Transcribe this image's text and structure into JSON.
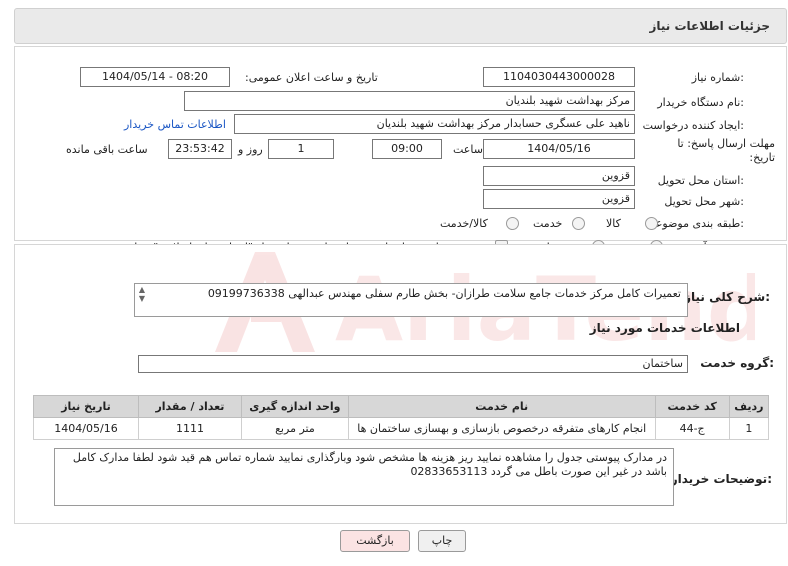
{
  "header": {
    "title": "جزئیات اطلاعات نیاز"
  },
  "need_number": {
    "label": "شماره نیاز:",
    "value": "1104030443000028"
  },
  "announce_datetime": {
    "label": "تاریخ و ساعت اعلان عمومی:",
    "value": "1404/05/14 - 08:20"
  },
  "buyer_org": {
    "label": "نام دستگاه خریدار:",
    "value": "مرکز بهداشت شهید بلندیان"
  },
  "requester": {
    "label": "ایجاد کننده درخواست:",
    "value": "ناهید علی عسگری حسابدار مرکز بهداشت شهید بلندیان",
    "contact_link": "اطلاعات تماس خریدار"
  },
  "deadline": {
    "label": "مهلت ارسال پاسخ: تا تاریخ:",
    "date": "1404/05/16",
    "time_label": "ساعت",
    "time": "09:00",
    "days": "1",
    "days_label": "روز و",
    "remaining": "23:53:42",
    "remaining_label": "ساعت باقی مانده"
  },
  "province": {
    "label": "استان محل تحویل:",
    "value": "قزوین"
  },
  "city": {
    "label": "شهر محل تحویل:",
    "value": "قزوین"
  },
  "category": {
    "label": "طبقه بندی موضوعی:",
    "options": [
      {
        "label": "کالا",
        "selected": false
      },
      {
        "label": "خدمت",
        "selected": false
      },
      {
        "label": "کالا/خدمت",
        "selected": false
      }
    ]
  },
  "purchase_type": {
    "label": "نوع فرآیند خرید :",
    "options": [
      {
        "label": "جزیی",
        "selected": false
      },
      {
        "label": "متوسط",
        "selected": false
      }
    ],
    "treasury_note": "پرداخت تمام یا بخشی از مبلغ خرید،از محل \"اسناد خزانه اسلامی\" خواهد بود."
  },
  "general_desc": {
    "label": "شرح کلی نیاز:",
    "value": "تعمیرات کامل مرکز خدمات جامع سلامت طرازان- بخش طارم سفلی  مهندس عبدالهی 09199736338"
  },
  "services_info": {
    "title": "اطلاعات خدمات مورد نیاز"
  },
  "service_group": {
    "label": "گروه خدمت:",
    "value": "ساختمان"
  },
  "table": {
    "headers": [
      "ردیف",
      "کد خدمت",
      "نام خدمت",
      "واحد اندازه گیری",
      "تعداد / مقدار",
      "تاریخ نیاز"
    ],
    "rows": [
      [
        "1",
        "ج-44",
        "انجام کارهای متفرقه درخصوص بازسازی و بهسازی ساختمان ها",
        "متر مربع",
        "1111",
        "1404/05/16"
      ]
    ]
  },
  "buyer_notes": {
    "label": "توضیحات خریدار:",
    "value": "در مدارک پیوستی جدول را مشاهده نمایید ریز هزینه ها مشخص شود وبارگذاری نمایید شماره تماس هم قید شود لطفا مدارک کامل باشد در غیر این صورت باطل می گردد 02833653113"
  },
  "buttons": {
    "print": "چاپ",
    "back": "بازگشت"
  },
  "watermark": {
    "text": "AriaTender.net"
  },
  "colors": {
    "link": "#1a56c4",
    "header_bg": "#eaeaea",
    "table_header_bg": "#d7d7d7",
    "back_button_bg": "#fbe3e3",
    "watermark": "#e05a5a"
  }
}
